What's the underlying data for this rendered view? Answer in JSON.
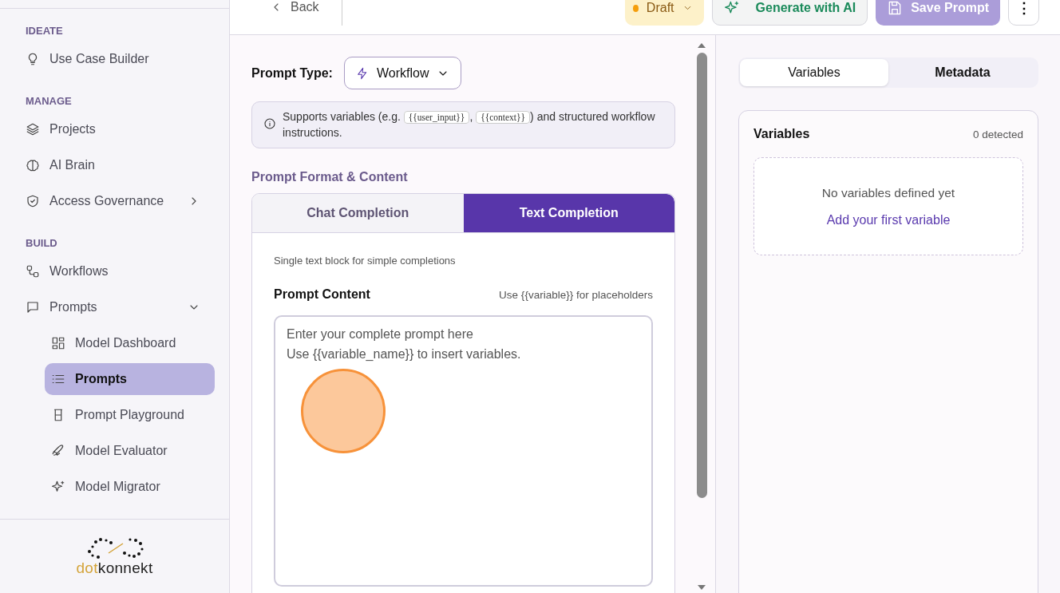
{
  "sidebar": {
    "sections": [
      {
        "heading": "IDEATE",
        "items": [
          {
            "label": "Use Case Builder",
            "selected": false
          }
        ]
      },
      {
        "heading": "MANAGE",
        "items": [
          {
            "label": "Projects",
            "selected": false
          },
          {
            "label": "AI Brain",
            "selected": false
          },
          {
            "label": "Access Governance",
            "selected": false,
            "expanded": false
          }
        ]
      },
      {
        "heading": "BUILD",
        "items": [
          {
            "label": "Workflows",
            "selected": false
          },
          {
            "label": "Prompts",
            "selected": false,
            "expanded": true,
            "children": [
              {
                "label": "Model Dashboard",
                "selected": false
              },
              {
                "label": "Prompts",
                "selected": true
              },
              {
                "label": "Prompt Playground",
                "selected": false
              },
              {
                "label": "Model Evaluator",
                "selected": false
              },
              {
                "label": "Model Migrator",
                "selected": false
              }
            ]
          }
        ]
      }
    ],
    "logo": {
      "prefix": "dot",
      "suffix": "konnekt"
    }
  },
  "top_bar": {
    "back": "Back",
    "status": {
      "label": "Draft",
      "color": "#f59e0b"
    },
    "generate": "Generate with AI",
    "save": {
      "label": "Save Prompt",
      "disabled": true
    },
    "more": "⋮"
  },
  "editor": {
    "prompt_type_label": "Prompt Type:",
    "prompt_type": "Workflow",
    "info": [
      {
        "kind": "text",
        "text": "Supports variables (e.g. "
      },
      {
        "kind": "code",
        "text": "{{user_input}}"
      },
      {
        "kind": "text",
        "text": ", "
      },
      {
        "kind": "code",
        "text": "{{context}}"
      },
      {
        "kind": "text",
        "text": ") and structured workflow instructions."
      }
    ],
    "section_title": "Prompt Format & Content",
    "tabs": [
      {
        "label": "Chat Completion",
        "selected": false
      },
      {
        "label": "Text Completion",
        "selected": true
      }
    ],
    "tab_description": "Single text block for simple completions",
    "content_label": "Prompt Content",
    "content_hint": "Use {{variable}} for placeholders",
    "placeholder": "Enter your complete prompt here\nUse {{variable_name}} to insert variables."
  },
  "side_panel": {
    "tabs": [
      {
        "label": "Variables",
        "selected": true
      },
      {
        "label": "Metadata",
        "selected": false
      }
    ],
    "card_title": "Variables",
    "count": "0 detected",
    "empty_text": "No variables defined yet",
    "add_link": "Add your first variable"
  }
}
